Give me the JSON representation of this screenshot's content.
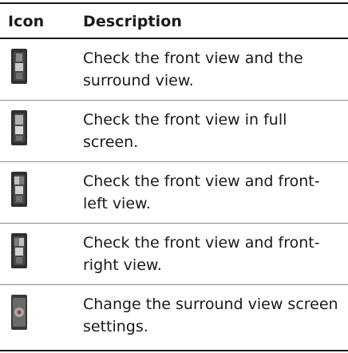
{
  "table": {
    "headers": {
      "icon": "Icon",
      "description": "Description"
    },
    "rows": [
      {
        "icon": "camera-view-front-surround-icon",
        "description": "Check the front view and the surround view."
      },
      {
        "icon": "camera-view-front-full-icon",
        "description": "Check the front view in full screen."
      },
      {
        "icon": "camera-view-front-left-icon",
        "description": "Check the front view and front-left view."
      },
      {
        "icon": "camera-view-front-right-icon",
        "description": "Check the front view and front-right view."
      },
      {
        "icon": "surround-view-settings-icon",
        "description": "Change the surround view screen settings."
      }
    ]
  }
}
